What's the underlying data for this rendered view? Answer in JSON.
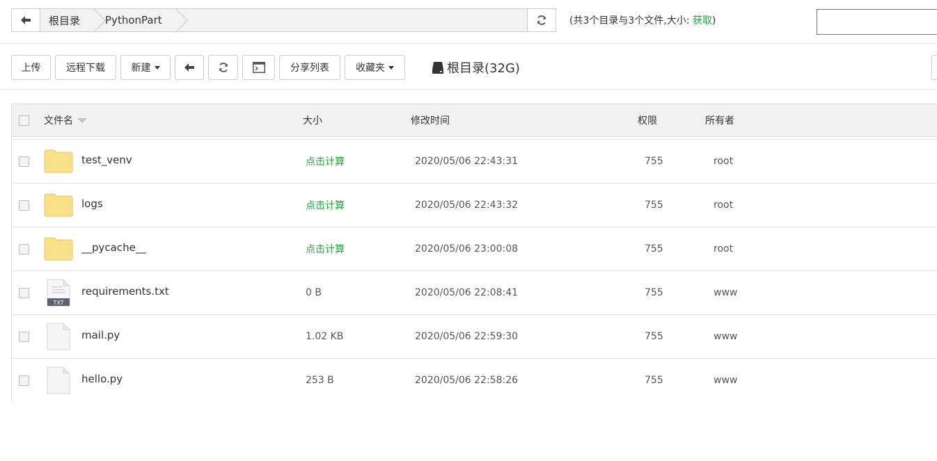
{
  "pathbar": {
    "crumbs": [
      "根目录",
      "PythonPart"
    ],
    "info_prefix": "(共3个目录与3个文件,大小:",
    "info_link": "获取",
    "info_suffix": ")"
  },
  "toolbar": {
    "upload": "上传",
    "remote_download": "远程下载",
    "new": "新建",
    "share_list": "分享列表",
    "favorites": "收藏夹",
    "disk_label": "根目录(32G)"
  },
  "table": {
    "headers": {
      "name": "文件名",
      "size": "大小",
      "mtime": "修改时间",
      "perm": "权限",
      "owner": "所有者"
    },
    "rows": [
      {
        "name": "test_venv",
        "type": "folder",
        "size": "点击计算",
        "mtime": "2020/05/06 22:43:31",
        "perm": "755",
        "owner": "root"
      },
      {
        "name": "logs",
        "type": "folder",
        "size": "点击计算",
        "mtime": "2020/05/06 22:43:32",
        "perm": "755",
        "owner": "root"
      },
      {
        "name": "__pycache__",
        "type": "folder",
        "size": "点击计算",
        "mtime": "2020/05/06 23:00:08",
        "perm": "755",
        "owner": "root"
      },
      {
        "name": "requirements.txt",
        "type": "txt",
        "size": "0 B",
        "mtime": "2020/05/06 22:08:41",
        "perm": "755",
        "owner": "www"
      },
      {
        "name": "mail.py",
        "type": "file",
        "size": "1.02 KB",
        "mtime": "2020/05/06 22:59:30",
        "perm": "755",
        "owner": "www"
      },
      {
        "name": "hello.py",
        "type": "file",
        "size": "253 B",
        "mtime": "2020/05/06 22:58:26",
        "perm": "755",
        "owner": "www"
      }
    ]
  },
  "icons": {
    "folder": "folder-icon",
    "txt": "txt-file-icon",
    "file": "file-icon",
    "txt_badge": "TXT"
  },
  "colors": {
    "accent": "#20a53a",
    "folder": "#fbe08a"
  }
}
